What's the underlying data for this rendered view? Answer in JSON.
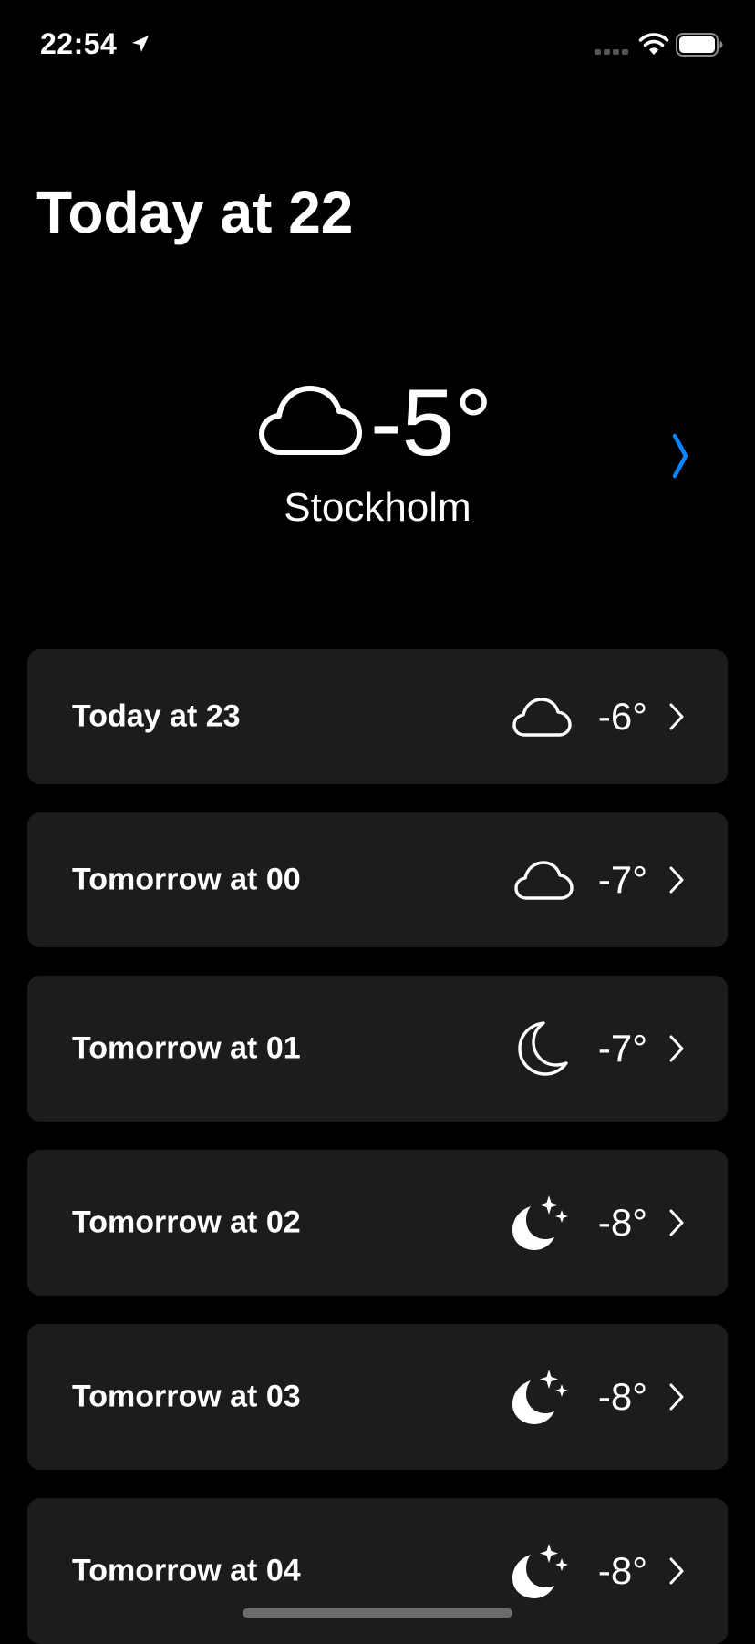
{
  "status_bar": {
    "time": "22:54",
    "icons": [
      "location-arrow-icon",
      "cellular-signal-icon",
      "wifi-icon",
      "battery-icon"
    ]
  },
  "header": {
    "title": "Today at 22"
  },
  "current": {
    "icon": "cloud-icon",
    "temperature": "-5°",
    "city": "Stockholm",
    "accent_color": "#0a84ff"
  },
  "forecast": [
    {
      "label": "Today at 23",
      "icon": "cloud-icon",
      "temperature": "-6°"
    },
    {
      "label": "Tomorrow at 00",
      "icon": "cloud-icon",
      "temperature": "-7°"
    },
    {
      "label": "Tomorrow at 01",
      "icon": "moon-icon",
      "temperature": "-7°"
    },
    {
      "label": "Tomorrow at 02",
      "icon": "moon-stars-icon",
      "temperature": "-8°"
    },
    {
      "label": "Tomorrow at 03",
      "icon": "moon-stars-icon",
      "temperature": "-8°"
    },
    {
      "label": "Tomorrow at 04",
      "icon": "moon-stars-icon",
      "temperature": "-8°"
    }
  ],
  "colors": {
    "background": "#000000",
    "card": "#1c1c1e",
    "text": "#ffffff"
  }
}
